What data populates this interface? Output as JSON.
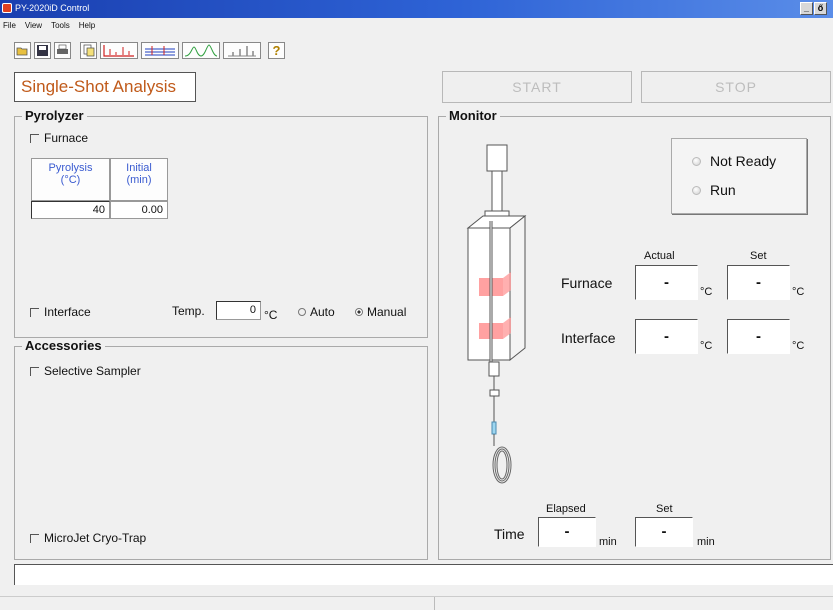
{
  "window": {
    "title": "PY-2020iD Control",
    "buttons": [
      "_",
      "ő"
    ]
  },
  "menu": [
    "File",
    "View",
    "Tools",
    "Help"
  ],
  "toolbar": {
    "icons": [
      "open-icon",
      "save-icon",
      "print-icon",
      "copy-icon",
      "chromatogram-icon",
      "sequence-icon",
      "peaks-icon",
      "bars-icon",
      "help-icon"
    ],
    "help_glyph": "?"
  },
  "title": "Single-Shot Analysis",
  "buttons": {
    "start": "START",
    "stop": "STOP"
  },
  "pyrolyzer": {
    "legend": "Pyrolyzer",
    "furnace_label": "Furnace",
    "col1_header": "Pyrolysis\n(°C)",
    "col2_header": "Initial\n(min)",
    "pyrolysis_value": "40",
    "initial_value": "0.00",
    "interface_label": "Interface",
    "temp_label": "Temp.",
    "temp_value": "0",
    "temp_unit": "°C",
    "auto_label": "Auto",
    "manual_label": "Manual",
    "mode_selected": "Manual"
  },
  "accessories": {
    "legend": "Accessories",
    "sampler_label": "Selective Sampler",
    "microjet_label": "MicroJet Cryo-Trap"
  },
  "monitor": {
    "legend": "Monitor",
    "not_ready": "Not Ready",
    "run": "Run",
    "actual_header": "Actual",
    "set_header": "Set",
    "furnace_label": "Furnace",
    "interface_label": "Interface",
    "furnace_actual": "-",
    "furnace_set": "-",
    "interface_actual": "-",
    "interface_set": "-",
    "unit_c": "°C",
    "elapsed_header": "Elapsed",
    "time_set_header": "Set",
    "time_label": "Time",
    "time_elapsed": "-",
    "time_set": "-",
    "unit_min": "min"
  },
  "status": {
    "message": ""
  },
  "colors": {
    "title_text": "#c05a1a",
    "header_text": "#3a5bd0",
    "furnace_zone": "#ff8a8a"
  }
}
